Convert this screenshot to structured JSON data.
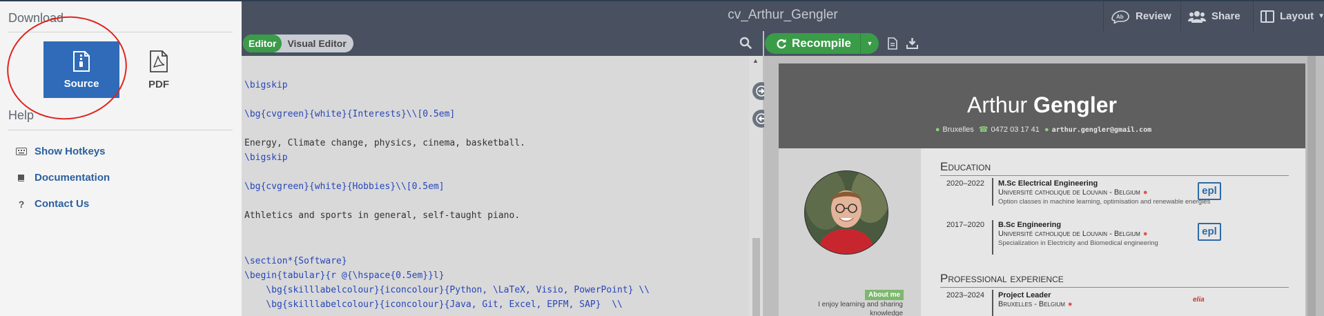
{
  "left_menu": {
    "download_heading": "Download",
    "source_label": "Source",
    "pdf_label": "PDF",
    "help_heading": "Help",
    "help_items": [
      {
        "label": "Show Hotkeys",
        "icon": "keyboard-icon"
      },
      {
        "label": "Documentation",
        "icon": "book-icon"
      },
      {
        "label": "Contact Us",
        "icon": "question-icon"
      }
    ]
  },
  "topbar": {
    "project_title": "cv_Arthur_Gengler",
    "review_label": "Review",
    "share_label": "Share",
    "layout_label": "Layout"
  },
  "editor_toolbar": {
    "editor_label": "Editor",
    "visual_editor_label": "Visual Editor"
  },
  "code": {
    "lines": [
      "",
      "\\bigskip",
      "",
      "\\bg{cvgreen}{white}{Interests}\\\\[0.5em]",
      "",
      "Energy, Climate change, physics, cinema, basketball.",
      "\\bigskip",
      "",
      "\\bg{cvgreen}{white}{Hobbies}\\\\[0.5em]",
      "",
      "Athletics and sports in general, self-taught piano.",
      "",
      "",
      "\\section*{Software}",
      "\\begin{tabular}{r @{\\hspace{0.5em}}l}",
      "    \\bg{skilllabelcolour}{iconcolour}{Python, \\LaTeX, Visio, PowerPoint} \\\\",
      "    \\bg{skilllabelcolour}{iconcolour}{Java, Git, Excel, EPFM, SAP}  \\\\"
    ]
  },
  "pdf_toolbar": {
    "recompile_label": "Recompile"
  },
  "cv": {
    "name_first": "Arthur",
    "name_last": "Gengler",
    "city": "Bruxelles",
    "phone": "0472 03 17 41",
    "email": "arthur.gengler@gmail.com",
    "about_tag": "About me",
    "about_text": "I enjoy learning and sharing knowledge",
    "education_heading": "Education",
    "education": [
      {
        "dates": "2020–2022",
        "title": "M.Sc Electrical Engineering",
        "institution": "Université catholique de Louvain - Belgium",
        "description": "Option classes in machine learning, optimisation and renewable energies",
        "logo": "epl"
      },
      {
        "dates": "2017–2020",
        "title": "B.Sc Engineering",
        "institution": "Université catholique de Louvain - Belgium",
        "description": "Specialization in Electricity and Biomedical engineering",
        "logo": "epl"
      }
    ],
    "experience_heading": "Professional experience",
    "experience": [
      {
        "dates": "2023–2024",
        "title": "Project Leader",
        "location": "Bruxelles - Belgium",
        "logo": "elia"
      }
    ]
  },
  "colors": {
    "accent_green": "#3a9b48",
    "source_blue": "#2f6bb8",
    "annotation_red": "#e0231e",
    "topbar": "#495161"
  }
}
